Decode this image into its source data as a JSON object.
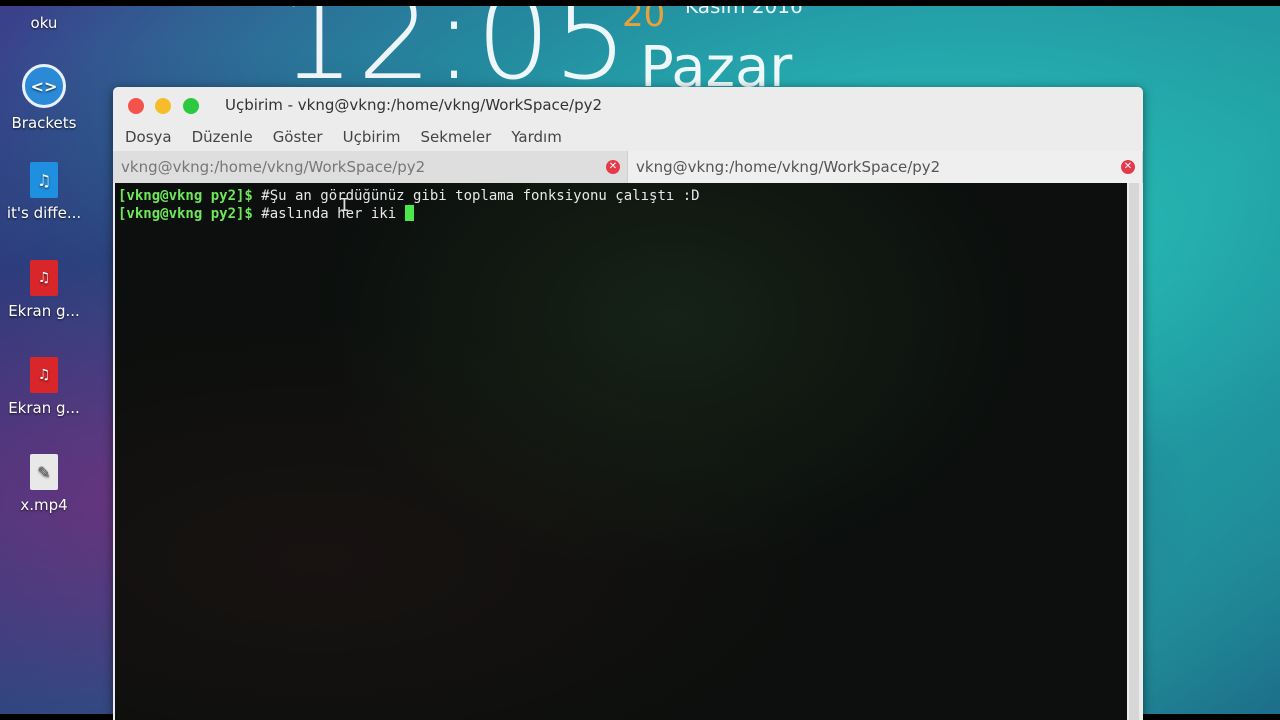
{
  "desktop": {
    "clock": "12:05",
    "date_day": "20",
    "date_month": "Kasım 2016",
    "weekday": "Pazar",
    "icons": [
      {
        "label": "oku",
        "icon": "folder-icon"
      },
      {
        "label": "Brackets",
        "icon": "brackets-app-icon"
      },
      {
        "label": "it's diffe...",
        "icon": "audio-file-icon",
        "glyph": "♫"
      },
      {
        "label": "Ekran g...",
        "icon": "png-file-icon",
        "glyph": "♫"
      },
      {
        "label": "Ekran g...",
        "icon": "png-file-icon",
        "glyph": "♫"
      },
      {
        "label": "x.mp4",
        "icon": "text-file-icon",
        "glyph": "✎"
      }
    ]
  },
  "window": {
    "title": "Uçbirim - vkng@vkng:/home/vkng/WorkSpace/py2",
    "menu": [
      "Dosya",
      "Düzenle",
      "Göster",
      "Uçbirim",
      "Sekmeler",
      "Yardım"
    ],
    "tabs": [
      {
        "label": "vkng@vkng:/home/vkng/WorkSpace/py2",
        "active": false
      },
      {
        "label": "vkng@vkng:/home/vkng/WorkSpace/py2",
        "active": true
      }
    ]
  },
  "terminal": {
    "lines": [
      {
        "prompt": "[vkng@vkng py2]$",
        "command": " #Şu an gördüğünüz gibi toplama fonksiyonu çalıştı :D"
      },
      {
        "prompt": "[vkng@vkng py2]$",
        "command": " #aslında her iki "
      }
    ]
  },
  "colors": {
    "prompt": "#6ee85a",
    "cursor": "#4ce84a",
    "close_button": "#f4524d",
    "minimize_button": "#f6bd28",
    "maximize_button": "#2ac940"
  }
}
